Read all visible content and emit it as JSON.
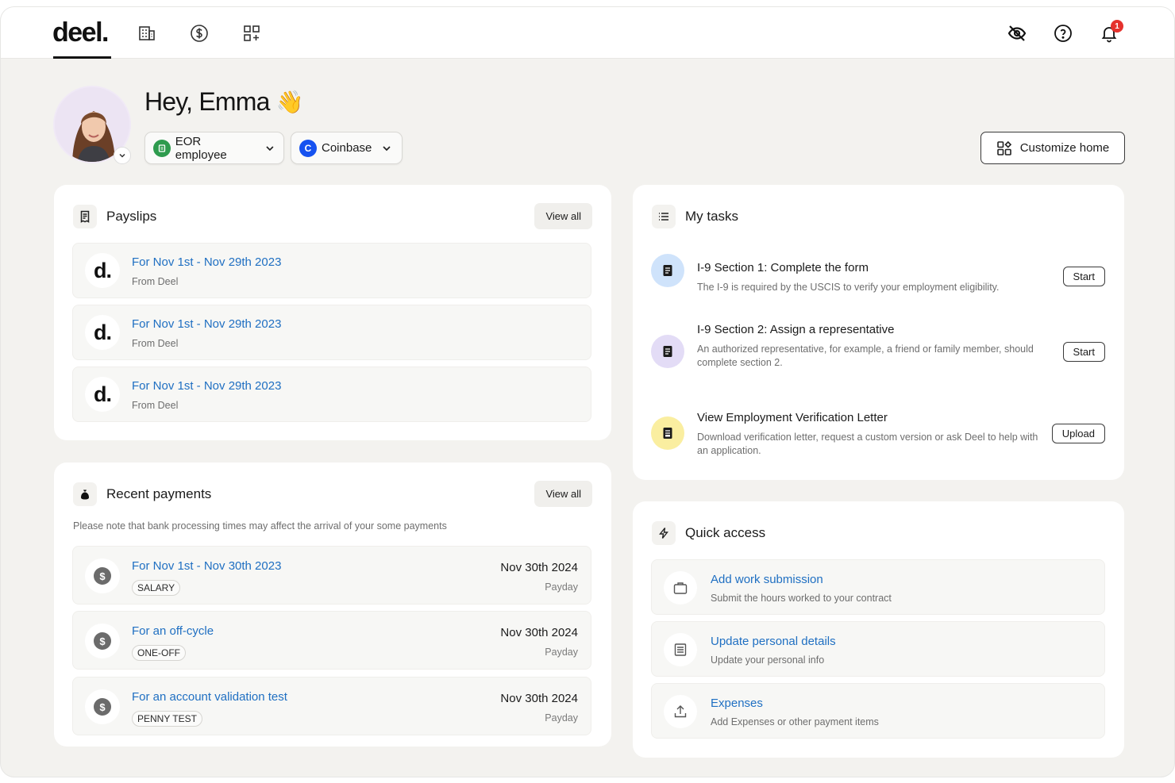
{
  "app": {
    "logo": "deel."
  },
  "notifications": {
    "count": "1"
  },
  "greeting": {
    "text": "Hey, Emma",
    "emoji": "👋"
  },
  "profile_pills": [
    {
      "label": "EOR employee",
      "icon_letter": "",
      "color": "#2e9b4e"
    },
    {
      "label": "Coinbase",
      "icon_letter": "C",
      "color": "#1652f0"
    }
  ],
  "customize": {
    "label": "Customize home"
  },
  "payslips": {
    "title": "Payslips",
    "view_all": "View all",
    "items": [
      {
        "title": "For Nov 1st - Nov 29th 2023",
        "from": "From Deel",
        "logo": "d."
      },
      {
        "title": "For Nov 1st - Nov 29th 2023",
        "from": "From Deel",
        "logo": "d."
      },
      {
        "title": "For Nov 1st - Nov 29th 2023",
        "from": "From Deel",
        "logo": "d."
      }
    ]
  },
  "payments": {
    "title": "Recent payments",
    "view_all": "View all",
    "note": "Please note that bank processing times may affect the arrival of your some payments",
    "items": [
      {
        "title": "For Nov 1st - Nov 30th 2023",
        "tag": "SALARY",
        "date": "Nov 30th 2024",
        "label": "Payday"
      },
      {
        "title": "For an off-cycle",
        "tag": "ONE-OFF",
        "date": "Nov 30th 2024",
        "label": "Payday"
      },
      {
        "title": "For an account validation test",
        "tag": "PENNY TEST",
        "date": "Nov 30th 2024",
        "label": "Payday"
      }
    ]
  },
  "tasks": {
    "title": "My tasks",
    "items": [
      {
        "title": "I-9 Section 1: Complete the form",
        "desc": "The I-9 is required by the USCIS to verify your employment eligibility.",
        "action": "Start",
        "color": "#cfe3fb"
      },
      {
        "title": "I-9 Section 2: Assign a representative",
        "desc": "An authorized representative, for example, a friend or family member, should\ncomplete section 2.",
        "action": "Start",
        "color": "#e3dcf6"
      },
      {
        "title": "View Employment Verification Letter",
        "desc": "Download verification letter, request a custom version or ask Deel to help with an application.",
        "action": "Upload",
        "color": "#faeea0"
      }
    ]
  },
  "quick_access": {
    "title": "Quick access",
    "items": [
      {
        "title": "Add work submission",
        "desc": "Submit the hours worked to your contract",
        "icon": "briefcase-icon"
      },
      {
        "title": "Update personal details",
        "desc": "Update your personal info",
        "icon": "document-icon"
      },
      {
        "title": "Expenses",
        "desc": "Add Expenses or other payment items",
        "icon": "upload-icon"
      }
    ]
  }
}
